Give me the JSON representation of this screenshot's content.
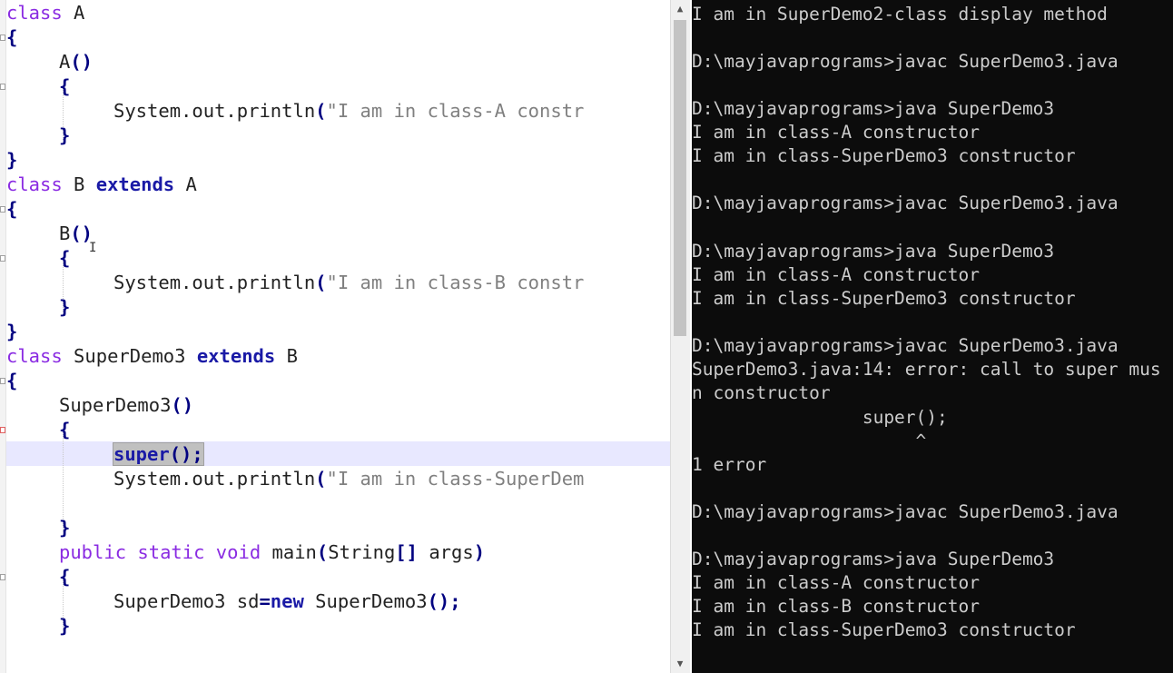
{
  "editor": {
    "lines": [
      [
        "class A"
      ],
      [
        "{"
      ],
      [
        "A()"
      ],
      [
        "{"
      ],
      [
        "System.out.println(\"I am in class-A constr"
      ],
      [
        "}"
      ],
      [
        "}"
      ],
      [
        "class B extends A"
      ],
      [
        "{"
      ],
      [
        "B()"
      ],
      [
        "{"
      ],
      [
        "System.out.println(\"I am in class-B constr"
      ],
      [
        "}"
      ],
      [
        "}"
      ],
      [
        "class SuperDemo3 extends B"
      ],
      [
        "{"
      ],
      [
        "SuperDemo3()"
      ],
      [
        "{"
      ],
      [
        "super();"
      ],
      [
        "System.out.println(\"I am in class-SuperDem"
      ],
      [
        "}"
      ],
      [
        "public static void main(String[] args)"
      ],
      [
        "{"
      ],
      [
        "SuperDemo3 sd=new SuperDemo3();"
      ],
      [
        "}"
      ]
    ],
    "tokens": {
      "l1_kw": "class",
      "l1_name": " A",
      "l2": "{",
      "l3_name": "A",
      "l3_br": "()",
      "l4": "{",
      "l5_a": "System.out.println",
      "l5_br": "(",
      "l5_str": "\"I am in class-A constr",
      "l6": "}",
      "l7": "}",
      "l8_kw": "class",
      "l8_name": " B ",
      "l8_ext": "extends",
      "l8_base": " A",
      "l9": "{",
      "l10_name": "B",
      "l10_br": "()",
      "l11": "{",
      "l12_a": "System.out.println",
      "l12_br": "(",
      "l12_str": "\"I am in class-B constr",
      "l13": "}",
      "l14": "}",
      "l15_kw": "class",
      "l15_name": " SuperDemo3 ",
      "l15_ext": "extends",
      "l15_base": " B",
      "l16": "{",
      "l17_name": "SuperDemo3",
      "l17_br": "()",
      "l18": "{",
      "l19_super": "super",
      "l19_br": "();",
      "l20_a": "System.out.println",
      "l20_br": "(",
      "l20_str": "\"I am in class-SuperDem",
      "l21": "}",
      "l22_kw": "public static void",
      "l22_main": " main",
      "l22_br1": "(",
      "l22_type": "String",
      "l22_br2": "[]",
      "l22_args": " args",
      "l22_br3": ")",
      "l23": "{",
      "l24_type": "SuperDemo3 sd",
      "l24_eq": "=",
      "l24_new": "new",
      "l24_ctor": " SuperDemo3",
      "l24_br": "();",
      "l25": "}"
    }
  },
  "terminal": {
    "lines": [
      "I am in SuperDemo2-class display method",
      "",
      "D:\\mayjavaprograms>javac SuperDemo3.java",
      "",
      "D:\\mayjavaprograms>java SuperDemo3",
      "I am in class-A constructor",
      "I am in class-SuperDemo3 constructor",
      "",
      "D:\\mayjavaprograms>javac SuperDemo3.java",
      "",
      "D:\\mayjavaprograms>java SuperDemo3",
      "I am in class-A constructor",
      "I am in class-SuperDemo3 constructor",
      "",
      "D:\\mayjavaprograms>javac SuperDemo3.java",
      "SuperDemo3.java:14: error: call to super mus",
      "n constructor",
      "                super();",
      "                     ^",
      "1 error",
      "",
      "D:\\mayjavaprograms>javac SuperDemo3.java",
      "",
      "D:\\mayjavaprograms>java SuperDemo3",
      "I am in class-A constructor",
      "I am in class-B constructor",
      "I am in class-SuperDemo3 constructor"
    ]
  },
  "scrollbar": {
    "up_icon": "▲",
    "down_icon": "▼"
  },
  "colors": {
    "keyword": "#8a2be2",
    "bold_keyword": "#1a1aa6",
    "string": "#808080",
    "terminal_bg": "#0c0c0c",
    "terminal_fg": "#cccccc"
  }
}
